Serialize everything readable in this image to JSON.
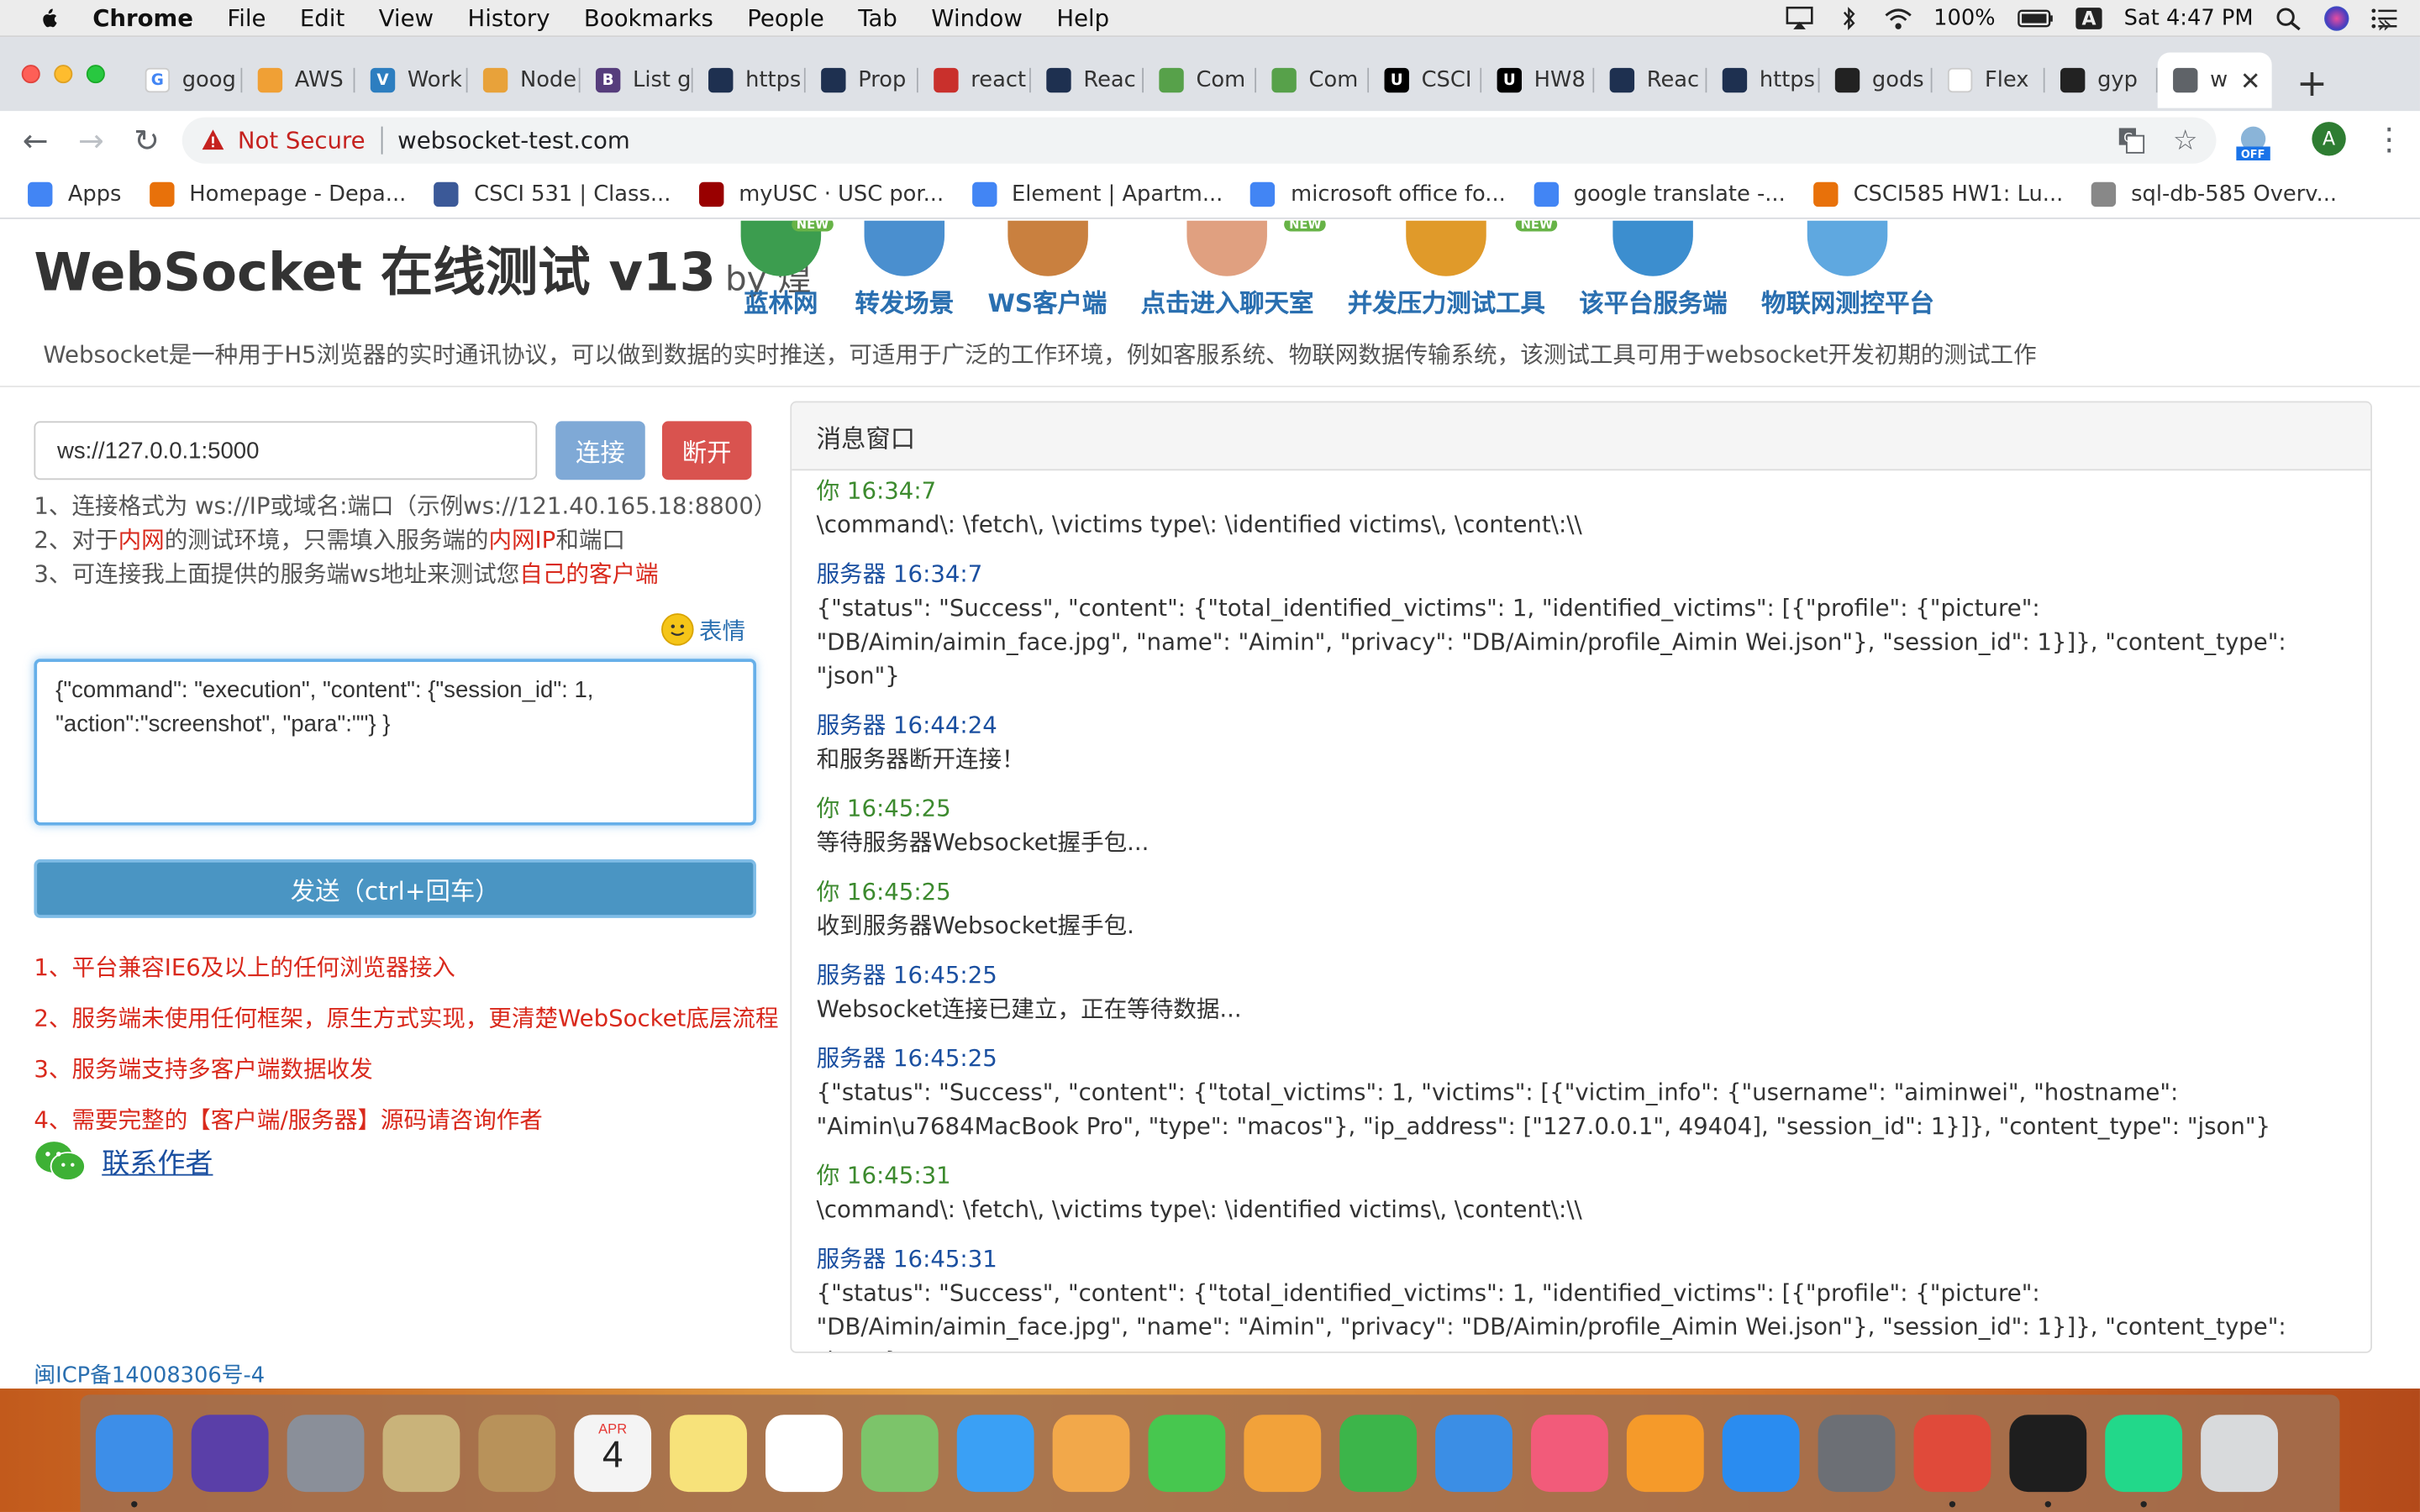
{
  "menubar": {
    "app_name": "Chrome",
    "items": [
      "File",
      "Edit",
      "View",
      "History",
      "Bookmarks",
      "People",
      "Tab",
      "Window",
      "Help"
    ],
    "battery": "100%",
    "input_source": "A",
    "clock": "Sat 4:47 PM"
  },
  "tabs": [
    {
      "label": "goog",
      "color": "#ffffff",
      "glyph": "G"
    },
    {
      "label": "AWS",
      "color": "#f0a035",
      "glyph": ""
    },
    {
      "label": "Work",
      "color": "#2d7ec0",
      "glyph": "V"
    },
    {
      "label": "Node",
      "color": "#e8a23a",
      "glyph": ""
    },
    {
      "label": "List g",
      "color": "#563d7c",
      "glyph": "B"
    },
    {
      "label": "https",
      "color": "#1e3050",
      "glyph": ""
    },
    {
      "label": "Prop",
      "color": "#1e3050",
      "glyph": ""
    },
    {
      "label": "react",
      "color": "#c9302c",
      "glyph": ""
    },
    {
      "label": "Reac",
      "color": "#1e3050",
      "glyph": ""
    },
    {
      "label": "Com",
      "color": "#57a14a",
      "glyph": ""
    },
    {
      "label": "Com",
      "color": "#57a14a",
      "glyph": ""
    },
    {
      "label": "CSCI",
      "color": "#000000",
      "glyph": "U"
    },
    {
      "label": "HW8",
      "color": "#000000",
      "glyph": "U"
    },
    {
      "label": "Reac",
      "color": "#1e3050",
      "glyph": ""
    },
    {
      "label": "https",
      "color": "#1e3050",
      "glyph": ""
    },
    {
      "label": "gods",
      "color": "#222222",
      "glyph": ""
    },
    {
      "label": "Flex",
      "color": "#ffffff",
      "glyph": ""
    },
    {
      "label": "gyp",
      "color": "#222222",
      "glyph": ""
    },
    {
      "label": "w",
      "color": "#5f6368",
      "glyph": "",
      "active": true
    }
  ],
  "omnibox": {
    "security": "Not Secure",
    "url": "websocket-test.com"
  },
  "bookmarks": [
    {
      "label": "Apps",
      "color": "#4285f4"
    },
    {
      "label": "Homepage - Depa...",
      "color": "#e8710a"
    },
    {
      "label": "CSCI 531 | Class...",
      "color": "#3b5998"
    },
    {
      "label": "myUSC · USC por...",
      "color": "#990000"
    },
    {
      "label": "Element | Apartm...",
      "color": "#4285f4"
    },
    {
      "label": "microsoft office fo...",
      "color": "#4285f4"
    },
    {
      "label": "google translate -...",
      "color": "#4285f4"
    },
    {
      "label": "CSCI585 HW1: Lu...",
      "color": "#e8710a"
    },
    {
      "label": "sql-db-585 Overv...",
      "color": "#888888"
    }
  ],
  "bookmarks_more": "»",
  "site": {
    "title": "WebSocket 在线测试 v13",
    "by": "by 煌",
    "nav": [
      {
        "label": "蓝林网",
        "color": "#3c9d4f",
        "badge": "NEW"
      },
      {
        "label": "转发场景",
        "color": "#4a8fcf",
        "badge": ""
      },
      {
        "label": "WS客户端",
        "color": "#c9803f",
        "badge": ""
      },
      {
        "label": "点击进入聊天室",
        "color": "#e0a080",
        "badge": "NEW"
      },
      {
        "label": "并发压力测试工具",
        "color": "#e09a2a",
        "badge": "NEW"
      },
      {
        "label": "该平台服务端",
        "color": "#3c8ecf",
        "badge": ""
      },
      {
        "label": "物联网测控平台",
        "color": "#5fa8e0",
        "badge": ""
      }
    ],
    "description": "Websocket是一种用于H5浏览器的实时通讯协议，可以做到数据的实时推送，可适用于广泛的工作环境，例如客服系统、物联网数据传输系统，该测试工具可用于websocket开发初期的测试工作"
  },
  "connect": {
    "address": "ws://127.0.0.1:5000",
    "connect_label": "连接",
    "disconnect_label": "断开"
  },
  "tips": {
    "line1": "1、连接格式为 ws://IP或域名:端口（示例ws://121.40.165.18:8800）",
    "line2_a": "2、对于",
    "line2_b": "内网",
    "line2_c": "的测试环境，只需填入服务端的",
    "line2_d": "内网IP",
    "line2_e": "和端口",
    "line3_a": "3、可连接我上面提供的服务端ws地址来测试您",
    "line3_b": "自己的客户端"
  },
  "emoji_label": "表情",
  "message_input": "{\"command\": \"execution\", \"content\": {\"session_id\": 1, \"action\":\"screenshot\", \"para\":\"\"} }",
  "send_label": "发送（ctrl+回车）",
  "features": [
    "1、平台兼容IE6及以上的任何浏览器接入",
    "2、服务端未使用任何框架，原生方式实现，更清楚WebSocket底层流程",
    "3、服务端支持多客户端数据收发",
    "4、需要完整的【客户端/服务器】源码请咨询作者"
  ],
  "contact_label": "联系作者",
  "icp": "闽ICP备14008306号-4",
  "panel": {
    "title": "消息窗口",
    "messages": [
      {
        "sender": "你 16:34:7",
        "kind": "you",
        "text": "\\command\\: \\fetch\\, \\victims type\\: \\identified victims\\, \\content\\:\\\\"
      },
      {
        "sender": "服务器 16:34:7",
        "kind": "srv",
        "text": "{\"status\": \"Success\", \"content\": {\"total_identified_victims\": 1, \"identified_victims\": [{\"profile\": {\"picture\": \"DB/Aimin/aimin_face.jpg\", \"name\": \"Aimin\", \"privacy\": \"DB/Aimin/profile_Aimin Wei.json\"}, \"session_id\": 1}]}, \"content_type\": \"json\"}"
      },
      {
        "sender": "服务器 16:44:24",
        "kind": "srv",
        "text": "和服务器断开连接！"
      },
      {
        "sender": "你 16:45:25",
        "kind": "you",
        "text": "等待服务器Websocket握手包..."
      },
      {
        "sender": "你 16:45:25",
        "kind": "you",
        "text": "收到服务器Websocket握手包."
      },
      {
        "sender": "服务器 16:45:25",
        "kind": "srv",
        "text": "Websocket连接已建立，正在等待数据..."
      },
      {
        "sender": "服务器 16:45:25",
        "kind": "srv",
        "text": "{\"status\": \"Success\", \"content\": {\"total_victims\": 1, \"victims\": [{\"victim_info\": {\"username\": \"aiminwei\", \"hostname\": \"Aimin\\u7684MacBook Pro\", \"type\": \"macos\"}, \"ip_address\": [\"127.0.0.1\", 49404], \"session_id\": 1}]}, \"content_type\": \"json\"}"
      },
      {
        "sender": "你 16:45:31",
        "kind": "you",
        "text": "\\command\\: \\fetch\\, \\victims type\\: \\identified victims\\, \\content\\:\\\\"
      },
      {
        "sender": "服务器 16:45:31",
        "kind": "srv",
        "text": "{\"status\": \"Success\", \"content\": {\"total_identified_victims\": 1, \"identified_victims\": [{\"profile\": {\"picture\": \"DB/Aimin/aimin_face.jpg\", \"name\": \"Aimin\", \"privacy\": \"DB/Aimin/profile_Aimin Wei.json\"}, \"session_id\": 1}]}, \"content_type\": \"json\"}"
      }
    ]
  },
  "dock": [
    {
      "name": "finder-icon",
      "color": "#3d8ee8",
      "running": true
    },
    {
      "name": "siri-icon",
      "color": "#5a3fa8",
      "running": false
    },
    {
      "name": "launchpad-icon",
      "color": "#8a8f99",
      "running": false
    },
    {
      "name": "mail-icon",
      "color": "#c9b37a",
      "running": false
    },
    {
      "name": "contacts-icon",
      "color": "#b8925a",
      "running": false
    },
    {
      "name": "calendar-icon",
      "color": "#f4f4f4",
      "running": false
    },
    {
      "name": "notes-icon",
      "color": "#f7e27a",
      "running": false
    },
    {
      "name": "reminders-icon",
      "color": "#ffffff",
      "running": false
    },
    {
      "name": "maps-icon",
      "color": "#7cc46a",
      "running": false
    },
    {
      "name": "messages-icon",
      "color": "#3aa0f5",
      "running": false
    },
    {
      "name": "photos-icon",
      "color": "#f2a84a",
      "running": false
    },
    {
      "name": "facetime-icon",
      "color": "#47c74f",
      "running": false
    },
    {
      "name": "pages-icon",
      "color": "#f2a23a",
      "running": false
    },
    {
      "name": "numbers-icon",
      "color": "#3cb54a",
      "running": false
    },
    {
      "name": "keynote-icon",
      "color": "#3b8ee5",
      "running": false
    },
    {
      "name": "music-icon",
      "color": "#f25b7a",
      "running": false
    },
    {
      "name": "books-icon",
      "color": "#f59a2a",
      "running": false
    },
    {
      "name": "app-store-icon",
      "color": "#2a8cf0",
      "running": false
    },
    {
      "name": "system-preferences-icon",
      "color": "#6c6f75",
      "running": false
    },
    {
      "name": "chrome-icon",
      "color": "#e04a3a",
      "running": true
    },
    {
      "name": "terminal-icon",
      "color": "#1e1e1e",
      "running": true
    },
    {
      "name": "pycharm-icon",
      "color": "#22d88a",
      "running": true
    },
    {
      "name": "trash-icon",
      "color": "#d8dadc",
      "running": false
    }
  ],
  "calendar": {
    "month": "APR",
    "day": "4"
  }
}
